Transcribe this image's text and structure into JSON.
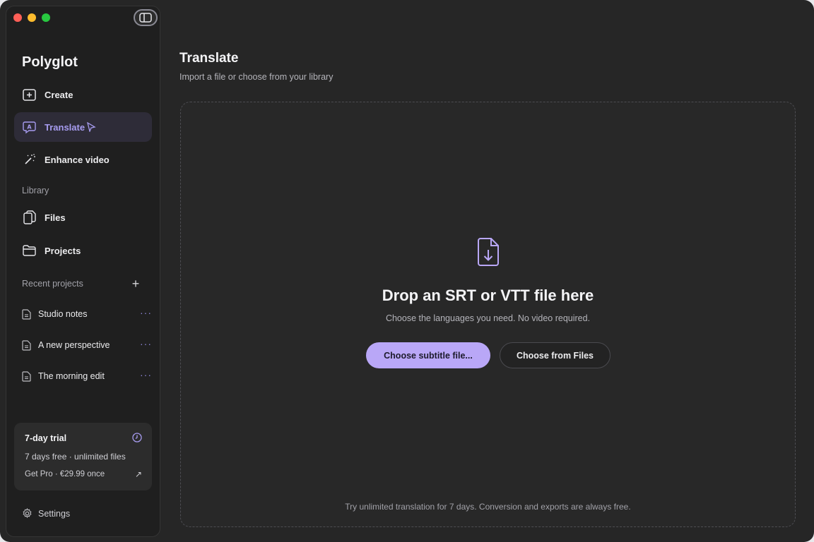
{
  "app": {
    "title": "Polyglot"
  },
  "nav": [
    {
      "label": "Create",
      "icon": "plus-square-icon",
      "active": false
    },
    {
      "label": "Translate",
      "icon": "translate-bubble-icon",
      "active": true
    },
    {
      "label": "Enhance video",
      "icon": "magic-wand-icon",
      "active": false
    }
  ],
  "library": {
    "label": "Library",
    "items": [
      {
        "label": "Files",
        "icon": "files-icon"
      },
      {
        "label": "Projects",
        "icon": "folder-icon"
      }
    ]
  },
  "recent": {
    "label": "Recent projects",
    "items": [
      {
        "label": "Studio notes"
      },
      {
        "label": "A new perspective"
      },
      {
        "label": "The morning edit"
      }
    ]
  },
  "trial": {
    "title": "7-day trial",
    "subtitle": "7 days free · unlimited files",
    "link": "Get Pro · €29.99 once"
  },
  "settings": {
    "label": "Settings"
  },
  "main": {
    "title": "Translate",
    "subtitle": "Import a file or choose from your library",
    "drop_title": "Drop an SRT or VTT file here",
    "drop_subtitle": "Choose the languages you need. No video required.",
    "primary_button": "Choose subtitle file...",
    "secondary_button": "Choose from Files",
    "footnote": "Try unlimited translation for 7 days. Conversion and exports are always free."
  },
  "colors": {
    "accent": "#b9a7f7",
    "accent_text": "#a79cf0",
    "background": "#262626",
    "sidebar": "#1f1f1f"
  }
}
